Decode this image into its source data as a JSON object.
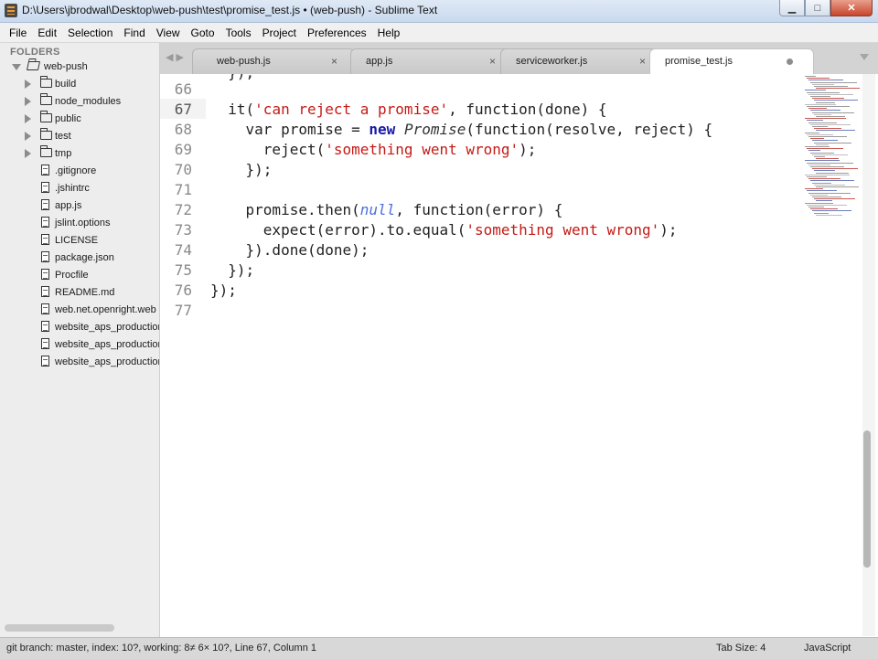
{
  "window": {
    "title": "D:\\Users\\jbrodwal\\Desktop\\web-push\\test\\promise_test.js • (web-push) - Sublime Text",
    "controls": {
      "minimize": "▁",
      "maximize": "□",
      "close": "✕"
    }
  },
  "menu": [
    "File",
    "Edit",
    "Selection",
    "Find",
    "View",
    "Goto",
    "Tools",
    "Project",
    "Preferences",
    "Help"
  ],
  "sidebar": {
    "header": "FOLDERS",
    "root": "web-push",
    "folders": [
      "build",
      "node_modules",
      "public",
      "test",
      "tmp"
    ],
    "files": [
      ".gitignore",
      ".jshintrc",
      "app.js",
      "jslint.options",
      "LICENSE",
      "package.json",
      "Procfile",
      "README.md",
      "web.net.openright.web",
      "website_aps_production",
      "website_aps_production",
      "website_aps_production"
    ]
  },
  "tabs": [
    {
      "label": "web-push.js",
      "close": "×",
      "active": false
    },
    {
      "label": "app.js",
      "close": "×",
      "active": false
    },
    {
      "label": "serviceworker.js",
      "close": "×",
      "active": false
    },
    {
      "label": "promise_test.js",
      "active": true,
      "modified": true
    }
  ],
  "editor": {
    "current_line": "67",
    "line_numbers": [
      "66",
      "67",
      "68",
      "69",
      "70",
      "71",
      "72",
      "73",
      "74",
      "75",
      "76",
      "77"
    ],
    "lines": [
      [
        {
          "t": "  }); ",
          "c": ""
        }
      ],
      [
        {
          "t": "  it(",
          "c": ""
        },
        {
          "t": "'can reject a promise'",
          "c": "str"
        },
        {
          "t": ", function(done) {",
          "c": ""
        }
      ],
      [
        {
          "t": "    var promise = ",
          "c": ""
        },
        {
          "t": "new",
          "c": "kw"
        },
        {
          "t": " ",
          "c": ""
        },
        {
          "t": "Promise",
          "c": "cls"
        },
        {
          "t": "(function(resolve, reject) {",
          "c": ""
        }
      ],
      [
        {
          "t": "      reject(",
          "c": ""
        },
        {
          "t": "'something went wrong'",
          "c": "str"
        },
        {
          "t": ");",
          "c": ""
        }
      ],
      [
        {
          "t": "    });",
          "c": ""
        }
      ],
      [
        {
          "t": "",
          "c": ""
        }
      ],
      [
        {
          "t": "    promise.then(",
          "c": ""
        },
        {
          "t": "null",
          "c": "nul"
        },
        {
          "t": ", function(error) {",
          "c": ""
        }
      ],
      [
        {
          "t": "      expect(error).to.equal(",
          "c": ""
        },
        {
          "t": "'something went wrong'",
          "c": "str"
        },
        {
          "t": ");",
          "c": ""
        }
      ],
      [
        {
          "t": "    }).done(done);",
          "c": ""
        }
      ],
      [
        {
          "t": "  });",
          "c": ""
        }
      ],
      [
        {
          "t": "});",
          "c": ""
        }
      ],
      [
        {
          "t": "",
          "c": ""
        }
      ]
    ]
  },
  "status": {
    "git": "git branch: master, index: 10?, working: 8≠ 6× 10?, Line 67, Column 1",
    "tab_size": "Tab Size: 4",
    "syntax": "JavaScript"
  }
}
